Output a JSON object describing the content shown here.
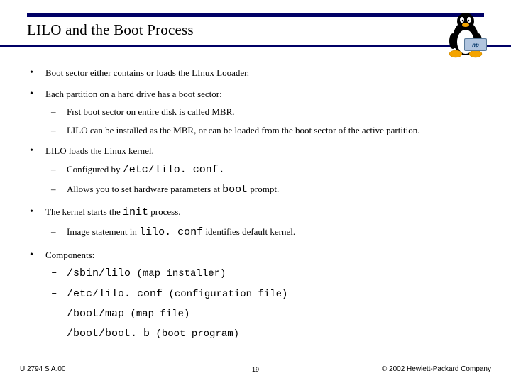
{
  "title": "LILO and the Boot Process",
  "bullets": {
    "b1": "Boot sector either contains or loads the LInux Looader.",
    "b2": "Each partition on a hard drive has a boot sector:",
    "b2s1": "Frst boot sector on entire disk is called MBR.",
    "b2s2": "LILO can be installed as the MBR, or can be loaded from the boot sector of the active partition.",
    "b3": "LILO loads the Linux kernel.",
    "b3s1_pre": "Configured by ",
    "b3s1_mono": "/etc/lilo. conf.",
    "b3s2_pre": "Allows you to set hardware parameters at ",
    "b3s2_mono": "boot",
    "b3s2_post": " prompt.",
    "b4_pre": "The kernel starts the ",
    "b4_mono": "init",
    "b4_post": " process.",
    "b4s1_pre": "Image statement in ",
    "b4s1_mono": "lilo. conf",
    "b4s1_post": " identifies default kernel.",
    "b5": "Components:",
    "b5s1_mono": "/sbin/lilo",
    "b5s1_post": " (map installer)",
    "b5s2_mono": "/etc/lilo. conf",
    "b5s2_post": " (configuration file)",
    "b5s3_mono": "/boot/map",
    "b5s3_post": " (map file)",
    "b5s4_mono": "/boot/boot. b",
    "b5s4_post": " (boot program)"
  },
  "footer": {
    "left": "U 2794 S A.00",
    "center": "19",
    "right": "© 2002 Hewlett-Packard Company"
  },
  "icons": {
    "hp": "hp"
  }
}
